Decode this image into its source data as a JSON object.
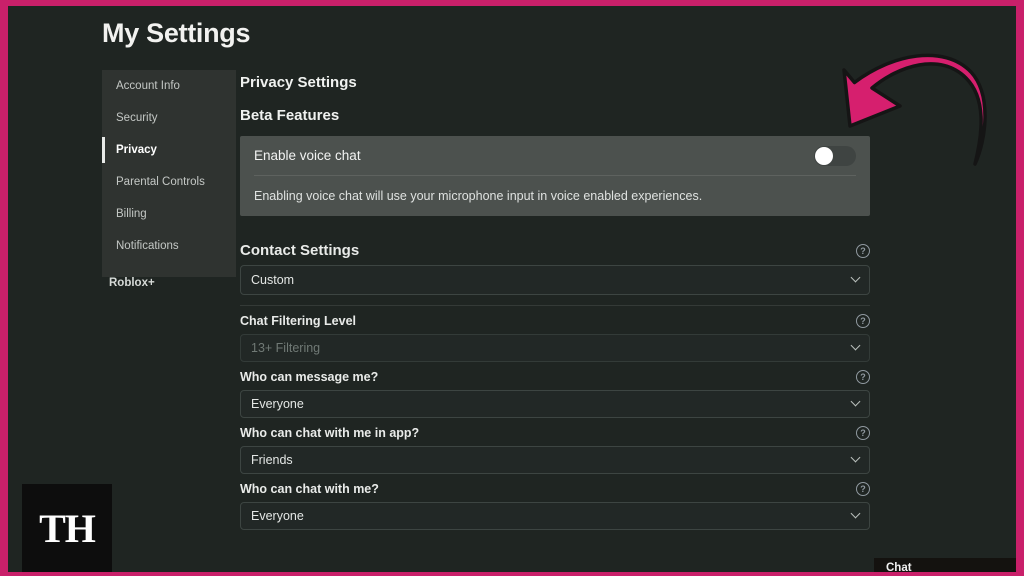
{
  "page": {
    "title": "My Settings",
    "background_color": "#1f2522",
    "frame_color": "#c9206a"
  },
  "sidebar": {
    "items": [
      {
        "label": "Account Info",
        "active": false
      },
      {
        "label": "Security",
        "active": false
      },
      {
        "label": "Privacy",
        "active": true
      },
      {
        "label": "Parental Controls",
        "active": false
      },
      {
        "label": "Billing",
        "active": false
      },
      {
        "label": "Notifications",
        "active": false
      }
    ],
    "extra_item": "Roblox+"
  },
  "main": {
    "privacy_heading": "Privacy Settings",
    "beta_heading": "Beta Features",
    "beta": {
      "toggle_label": "Enable voice chat",
      "toggle_state": "off",
      "description": "Enabling voice chat will use your microphone input in voice enabled experiences."
    },
    "contact": {
      "heading": "Contact Settings",
      "help_icon": "question-mark-circle-icon",
      "primary_select": {
        "value": "Custom",
        "chevron": "chevron-down-icon"
      },
      "fields": [
        {
          "label": "Chat Filtering Level",
          "value": "13+ Filtering",
          "disabled": true
        },
        {
          "label": "Who can message me?",
          "value": "Everyone",
          "disabled": false
        },
        {
          "label": "Who can chat with me in app?",
          "value": "Friends",
          "disabled": false
        },
        {
          "label": "Who can chat with me?",
          "value": "Everyone",
          "disabled": false
        }
      ]
    }
  },
  "annotation": {
    "arrow": {
      "shape": "curved-arrow-icon",
      "fill_color": "#d61f6e",
      "stroke_color": "#151515",
      "points_to": "voice-chat-toggle"
    }
  },
  "watermark": {
    "text": "TH"
  },
  "chat_widget": {
    "label": "Chat"
  }
}
